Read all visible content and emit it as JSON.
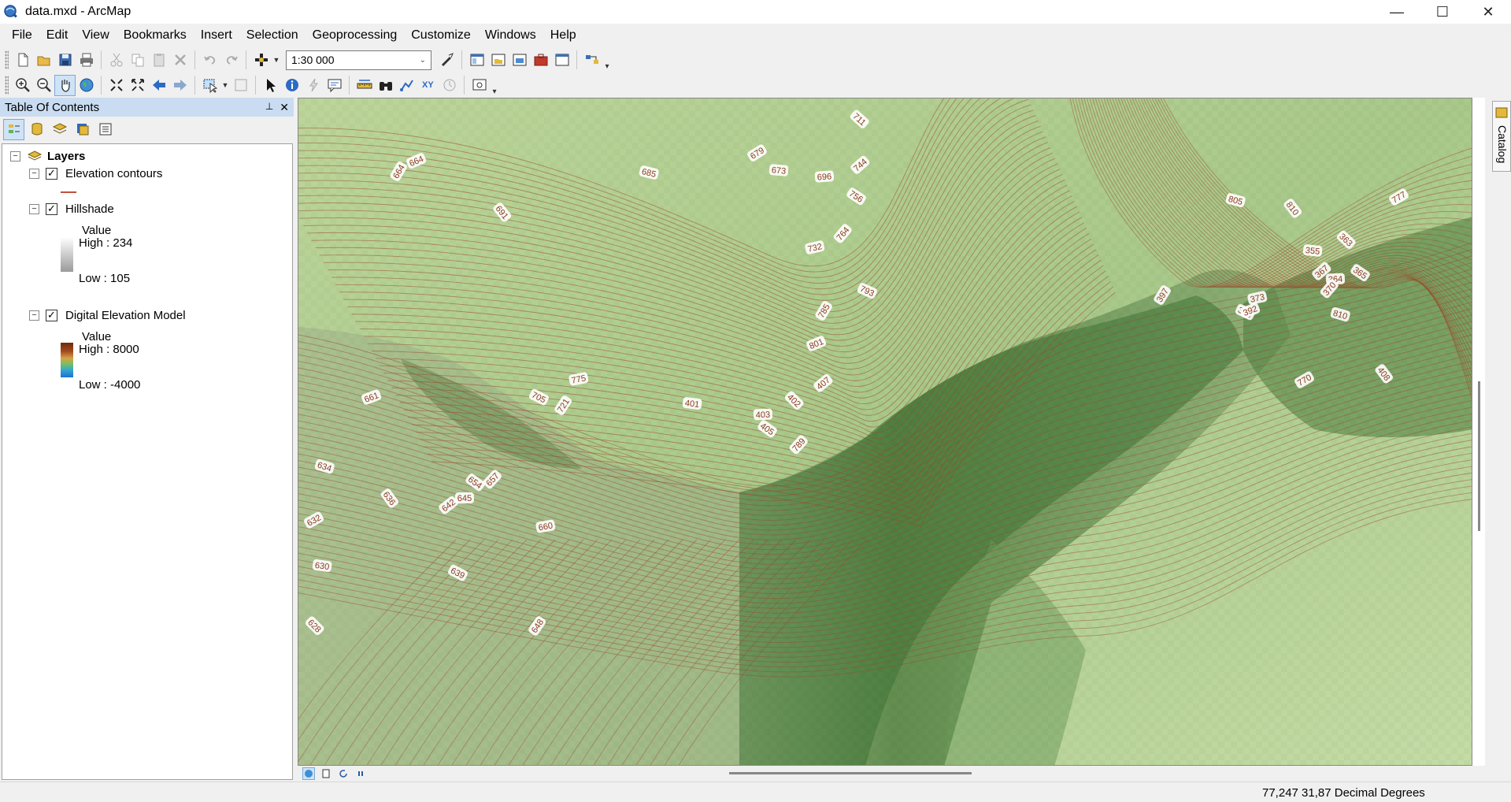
{
  "window": {
    "title": "data.mxd - ArcMap",
    "controls": {
      "minimize": "—",
      "maximize": "☐",
      "close": "✕"
    }
  },
  "menu": [
    "File",
    "Edit",
    "View",
    "Bookmarks",
    "Insert",
    "Selection",
    "Geoprocessing",
    "Customize",
    "Windows",
    "Help"
  ],
  "standard_toolbar": {
    "scale": "1:30 000"
  },
  "toc": {
    "title": "Table Of Contents",
    "pin": "📌",
    "close": "✕",
    "root": "Layers",
    "layers": [
      {
        "name": "Elevation contours",
        "checked": true
      },
      {
        "name": "Hillshade",
        "checked": true,
        "legend_title": "Value",
        "high": "High : 234",
        "low": "Low : 105"
      },
      {
        "name": "Digital Elevation Model",
        "checked": true,
        "legend_title": "Value",
        "high": "High : 8000",
        "low": "Low : -4000"
      }
    ]
  },
  "map": {
    "contour_labels": [
      "664",
      "664",
      "685",
      "691",
      "679",
      "673",
      "711",
      "744",
      "696",
      "756",
      "764",
      "732",
      "793",
      "785",
      "801",
      "805",
      "810",
      "777",
      "355",
      "363",
      "367",
      "364",
      "365",
      "370",
      "373",
      "376",
      "397",
      "392",
      "810",
      "408",
      "770",
      "401",
      "402",
      "407",
      "403",
      "405",
      "789",
      "775",
      "705",
      "721",
      "661",
      "634",
      "636",
      "632",
      "630",
      "628",
      "642",
      "645",
      "654",
      "657",
      "660",
      "639",
      "648"
    ],
    "colors": {
      "dem_high": "#6b2a0d",
      "dem_low": "#1e6fd9",
      "contour": "#9a4a2a"
    }
  },
  "right_dock": {
    "catalog_label": "Catalog"
  },
  "status": {
    "coordinates": "77,247  31,87 Decimal Degrees"
  }
}
